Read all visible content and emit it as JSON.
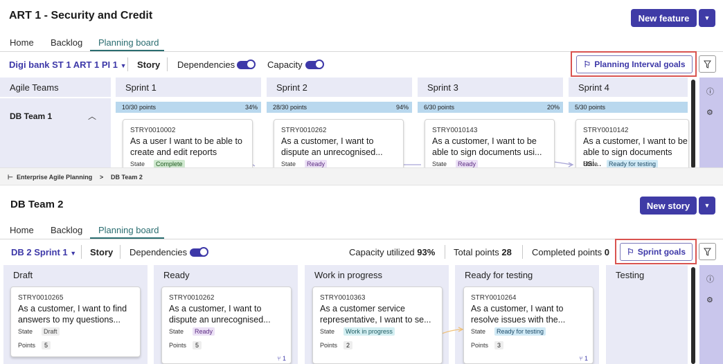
{
  "top": {
    "title": "ART 1 - Security and Credit",
    "primary_button": "New feature",
    "tabs": [
      "Home",
      "Backlog",
      "Planning board"
    ],
    "toolbar": {
      "pi_select": "Digi bank ST 1 ART 1 PI 1",
      "story": "Story",
      "dependencies": "Dependencies",
      "capacity": "Capacity",
      "goals_button": "Planning Interval goals"
    },
    "teams_header": "Agile Teams",
    "team_name": "DB Team 1",
    "sprints": [
      {
        "name": "Sprint 1",
        "points": "10/30 points",
        "pct": "34%",
        "fill": 0.34
      },
      {
        "name": "Sprint 2",
        "points": "28/30 points",
        "pct": "94%",
        "fill": 0.94
      },
      {
        "name": "Sprint 3",
        "points": "6/30 points",
        "pct": "20%",
        "fill": 0.2
      },
      {
        "name": "Sprint 4",
        "points": "5/30 points",
        "pct": "",
        "fill": 0.17
      }
    ],
    "cards": [
      {
        "id": "STRY0010002",
        "title": "As a user I want to be able to create and edit reports",
        "state_label": "State",
        "state": "Complete"
      },
      {
        "id": "STRY0010262",
        "title": "As a customer, I want to dispute an unrecognised...",
        "state_label": "State",
        "state": "Ready"
      },
      {
        "id": "STRY0010143",
        "title": "As a customer, I want to be able to sign documents usi...",
        "state_label": "State",
        "state": "Ready"
      },
      {
        "id": "STRY0010142",
        "title": "As a customer, I want to be able to sign documents usi...",
        "state_label": "State",
        "state": "Ready for testing"
      }
    ]
  },
  "breadcrumb": {
    "root": "Enterprise Agile Planning",
    "sep": ">",
    "current": "DB Team 2"
  },
  "bottom": {
    "title": "DB Team 2",
    "primary_button": "New story",
    "tabs": [
      "Home",
      "Backlog",
      "Planning board"
    ],
    "toolbar": {
      "sprint_select": "DB 2 Sprint 1",
      "story": "Story",
      "dependencies": "Dependencies",
      "capacity_label": "Capacity utilized",
      "capacity_value": "93%",
      "total_label": "Total points",
      "total_value": "28",
      "completed_label": "Completed points",
      "completed_value": "0",
      "goals_button": "Sprint goals"
    },
    "columns": [
      "Draft",
      "Ready",
      "Work in progress",
      "Ready for testing",
      "Testing"
    ],
    "cards": [
      {
        "id": "STRY0010265",
        "title": "As a customer, I want to find answers to my questions...",
        "state_label": "State",
        "state": "Draft",
        "points_label": "Points",
        "points": "5",
        "deps": ""
      },
      {
        "id": "STRY0010262",
        "title": "As a customer, I want to dispute an unrecognised...",
        "state_label": "State",
        "state": "Ready",
        "points_label": "Points",
        "points": "5",
        "deps": "1"
      },
      {
        "id": "STRY0010363",
        "title": "As a customer service representative, I want to se...",
        "state_label": "State",
        "state": "Work in progress",
        "points_label": "Points",
        "points": "2",
        "deps": ""
      },
      {
        "id": "STRY0010264",
        "title": "As a customer, I want to resolve issues with the...",
        "state_label": "State",
        "state": "Ready for testing",
        "points_label": "Points",
        "points": "3",
        "deps": "1"
      }
    ]
  },
  "colors": {
    "accent": "#3f3ba6",
    "tab_active": "#2a6d70",
    "highlight_frame": "#d9534f",
    "rail": "#c9c6ec"
  }
}
